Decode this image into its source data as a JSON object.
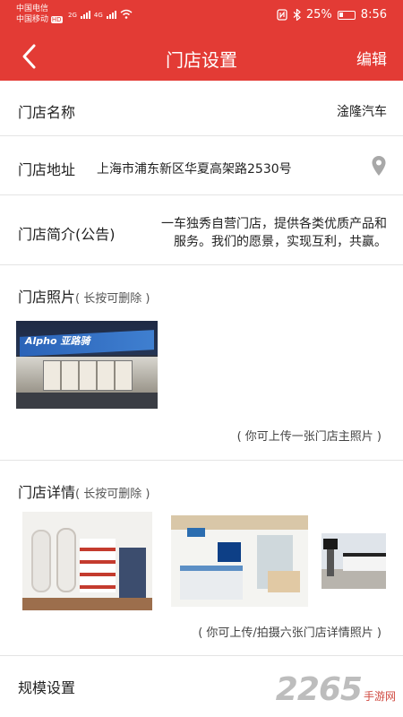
{
  "status": {
    "carrier1": "中国电信",
    "carrier2": "中国移动",
    "net1": "2G",
    "net2": "4G",
    "hd": "HD",
    "battery": "25%",
    "time": "8:56"
  },
  "nav": {
    "title": "门店设置",
    "edit": "编辑"
  },
  "store": {
    "name_label": "门店名称",
    "name_value": "淦隆汽车",
    "address_label": "门店地址",
    "address_value": "上海市浦东新区华夏高架路2530号",
    "intro_label": "门店简介(公告)",
    "intro_line1": "一车独秀自营门店，提供各类优质产品和",
    "intro_line2": "服务。我们的愿景，实现互利，共赢。",
    "photo_label": "门店照片",
    "photo_hint": "( 长按可删除 )",
    "photo_sign": "Alpho 亚路骑",
    "photo_note": "( 你可上传一张门店主照片 )",
    "detail_label": "门店详情",
    "detail_hint": "( 长按可删除 )",
    "detail_note": "( 你可上传/拍摄六张门店详情照片 )",
    "scale_label": "规模设置"
  },
  "watermark": {
    "number": "2265",
    "suffix": "手游网"
  },
  "colors": {
    "brand_red": "#e33b35",
    "divider": "#e4e4e4"
  }
}
